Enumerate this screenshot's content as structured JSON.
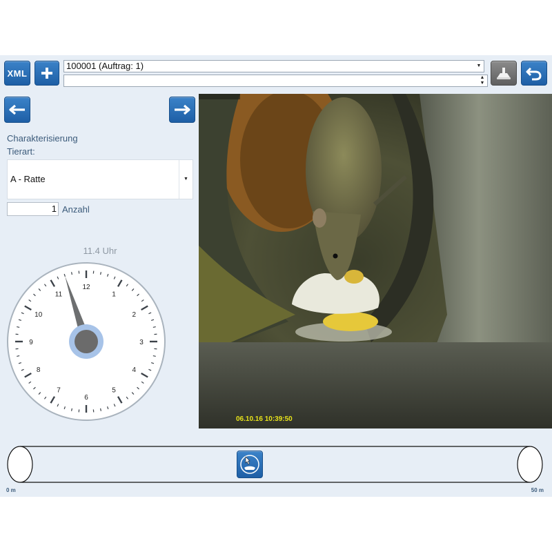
{
  "toolbar": {
    "xml_label": "XML",
    "record_combo_value": "100001 (Auftrag: 1)",
    "second_combo_value": ""
  },
  "panel": {
    "section_label": "Charakterisierung",
    "animal_type_label": "Tierart:",
    "animal_type_value": "A - Ratte",
    "count_value": "1",
    "count_label": "Anzahl"
  },
  "clock": {
    "caption": "11.4 Uhr",
    "hour_value": 11.4,
    "numbers": [
      "12",
      "1",
      "2",
      "3",
      "4",
      "5",
      "6",
      "7",
      "8",
      "9",
      "10",
      "11"
    ]
  },
  "video": {
    "timestamp": "06.10.16 10:39:50"
  },
  "pipe": {
    "start_label": "0 m",
    "end_label": "50 m",
    "marker_position": 0.45
  },
  "colors": {
    "accent": "#2b73bd",
    "panel_bg": "#e7eef6",
    "timestamp": "#e7e21a"
  }
}
